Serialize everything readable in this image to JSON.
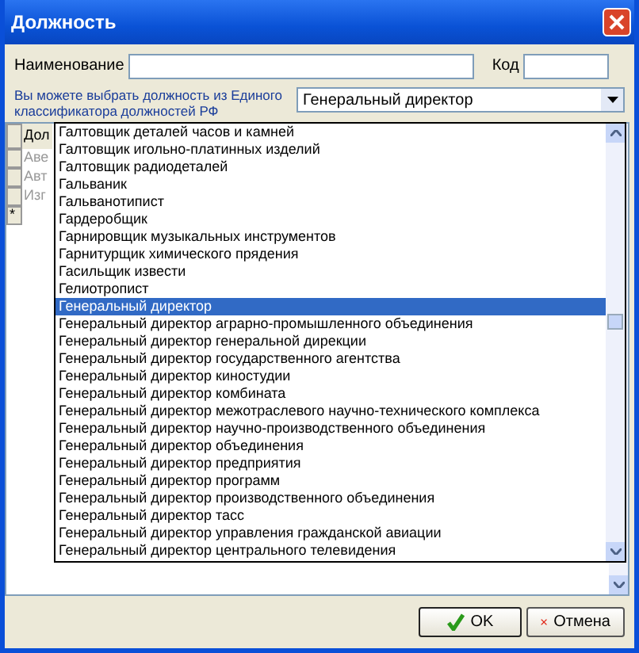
{
  "window": {
    "title": "Должность"
  },
  "form": {
    "name_label": "Наименование",
    "code_label": "Код",
    "classifier_hint": "Вы можете выбрать должность из Единого классификатора должностей РФ",
    "classifier_value": "Генеральный директор"
  },
  "grid": {
    "columns": [
      "Дол"
    ],
    "rows": [
      "Аве",
      "Авт",
      "Изг"
    ],
    "new_row_marker": "*"
  },
  "dropdown": {
    "items": [
      {
        "label": "Галтовщик деталей часов и камней",
        "selected": false
      },
      {
        "label": "Галтовщик игольно-платинных изделий",
        "selected": false
      },
      {
        "label": "Галтовщик радиодеталей",
        "selected": false
      },
      {
        "label": "Гальваник",
        "selected": false
      },
      {
        "label": "Гальванотипист",
        "selected": false
      },
      {
        "label": "Гардеробщик",
        "selected": false
      },
      {
        "label": "Гарнировщик музыкальных инструментов",
        "selected": false
      },
      {
        "label": "Гарнитурщик химического прядения",
        "selected": false
      },
      {
        "label": "Гасильщик извести",
        "selected": false
      },
      {
        "label": "Гелиотропист",
        "selected": false
      },
      {
        "label": "Генеральный директор",
        "selected": true
      },
      {
        "label": "Генеральный директор аграрно-промышленного объединения",
        "selected": false
      },
      {
        "label": "Генеральный директор генеральной дирекции",
        "selected": false
      },
      {
        "label": "Генеральный директор государственного агентства",
        "selected": false
      },
      {
        "label": "Генеральный директор киностудии",
        "selected": false
      },
      {
        "label": "Генеральный директор комбината",
        "selected": false
      },
      {
        "label": "Генеральный директор межотраслевого научно-технического комплекса",
        "selected": false
      },
      {
        "label": "Генеральный директор научно-производственного объединения",
        "selected": false
      },
      {
        "label": "Генеральный директор объединения",
        "selected": false
      },
      {
        "label": "Генеральный директор предприятия",
        "selected": false
      },
      {
        "label": "Генеральный директор программ",
        "selected": false
      },
      {
        "label": "Генеральный директор производственного объединения",
        "selected": false
      },
      {
        "label": "Генеральный директор тасс",
        "selected": false
      },
      {
        "label": "Генеральный директор управления гражданской авиации",
        "selected": false
      },
      {
        "label": "Генеральный директор центрального телевидения",
        "selected": false
      }
    ]
  },
  "buttons": [
    {
      "label": "OK",
      "kind": "ok"
    },
    {
      "label": "Отмена",
      "kind": "cancel"
    }
  ]
}
